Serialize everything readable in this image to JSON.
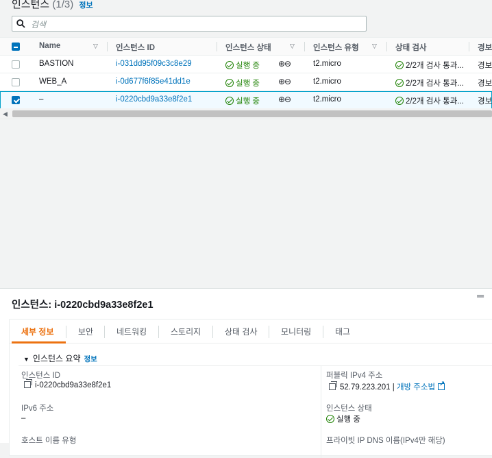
{
  "header": {
    "title": "인스턴스",
    "count": "(1/3)",
    "info": "정보"
  },
  "search": {
    "placeholder": "검색"
  },
  "table": {
    "columns": [
      "Name",
      "인스턴스 ID",
      "인스턴스 상태",
      "인스턴스 유형",
      "상태 검사",
      "경보"
    ],
    "rows": [
      {
        "name": "BASTION",
        "id": "i-031dd95f09c3c8e29",
        "state": "실행 중",
        "type": "t2.micro",
        "check": "2/2개 검사 통과...",
        "alarm": "경보",
        "selected": false
      },
      {
        "name": "WEB_A",
        "id": "i-0d677f6f85e41dd1e",
        "state": "실행 중",
        "type": "t2.micro",
        "check": "2/2개 검사 통과...",
        "alarm": "경보",
        "selected": false
      },
      {
        "name": "–",
        "id": "i-0220cbd9a33e8f2e1",
        "state": "실행 중",
        "type": "t2.micro",
        "check": "2/2개 검사 통과...",
        "alarm": "경보",
        "selected": true
      }
    ]
  },
  "detail": {
    "title_prefix": "인스턴스: ",
    "instance_id": "i-0220cbd9a33e8f2e1",
    "tabs": [
      "세부 정보",
      "보안",
      "네트워킹",
      "스토리지",
      "상태 검사",
      "모니터링",
      "태그"
    ],
    "summary_label": "인스턴스 요약",
    "summary_info": "정보",
    "fields": {
      "instance_id_label": "인스턴스 ID",
      "instance_id_value": "i-0220cbd9a33e8f2e1",
      "public_ipv4_label": "퍼블릭 IPv4 주소",
      "public_ipv4_value": "52.79.223.201",
      "public_ipv4_sep": " | ",
      "open_address_link": "개방 주소법",
      "ipv6_label": "IPv6 주소",
      "ipv6_value": "–",
      "state_label": "인스턴스 상태",
      "state_value": "실행 중",
      "hostname_type_label": "호스트 이름 유형",
      "private_dns_label": "프라이빗 IP DNS 이름(IPv4만 해당)"
    }
  },
  "colors": {
    "accent": "#ec7211",
    "link": "#0073bb",
    "success": "#1d8102"
  }
}
